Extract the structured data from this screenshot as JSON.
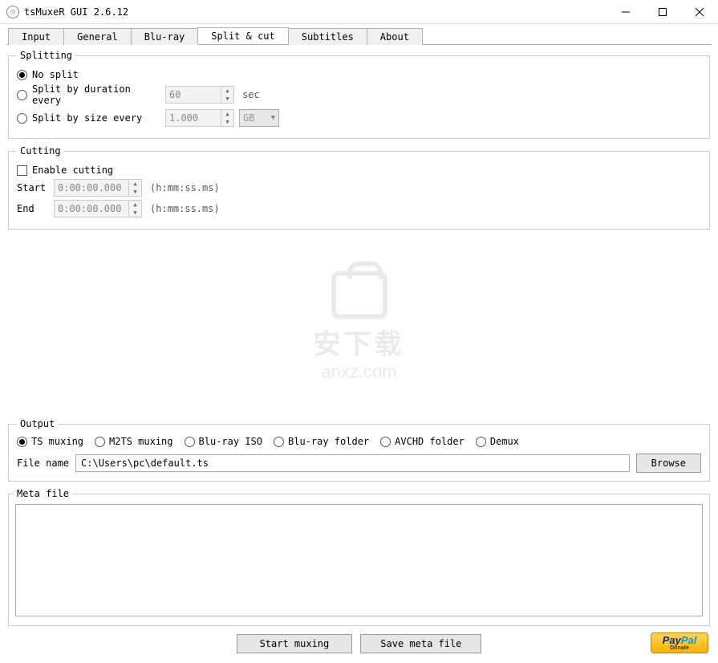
{
  "window": {
    "title": "tsMuxeR GUI 2.6.12"
  },
  "tabs": {
    "items": [
      {
        "label": "Input"
      },
      {
        "label": "General"
      },
      {
        "label": "Blu-ray"
      },
      {
        "label": "Split & cut"
      },
      {
        "label": "Subtitles"
      },
      {
        "label": "About"
      }
    ],
    "active_index": 3
  },
  "splitting": {
    "legend": "Splitting",
    "no_split_label": "No split",
    "by_duration_label": "Split by duration every",
    "duration_value": "60",
    "duration_unit": "sec",
    "by_size_label": "Split by size every",
    "size_value": "1.000",
    "size_unit": "GB"
  },
  "cutting": {
    "legend": "Cutting",
    "enable_label": "Enable cutting",
    "start_label": "Start",
    "start_value": "0:00:00.000",
    "end_label": "End",
    "end_value": "0:00:00.000",
    "format_hint": "(h:mm:ss.ms)"
  },
  "output": {
    "legend": "Output",
    "modes": [
      {
        "label": "TS muxing"
      },
      {
        "label": "M2TS muxing"
      },
      {
        "label": "Blu-ray ISO"
      },
      {
        "label": "Blu-ray folder"
      },
      {
        "label": "AVCHD folder"
      },
      {
        "label": "Demux"
      }
    ],
    "selected_mode": 0,
    "filename_label": "File name",
    "filename_value": "C:\\Users\\pc\\default.ts",
    "browse_label": "Browse"
  },
  "meta": {
    "legend": "Meta file",
    "content": ""
  },
  "buttons": {
    "start_muxing": "Start muxing",
    "save_meta": "Save meta file",
    "donate_top": "PayPal",
    "donate_bottom": "Donate"
  },
  "watermark": {
    "line1": "安下载",
    "line2": "anxz.com"
  }
}
